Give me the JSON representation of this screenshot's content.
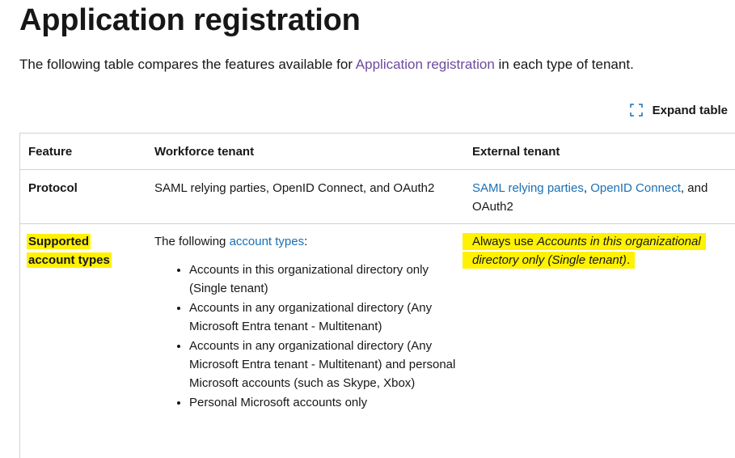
{
  "page": {
    "title": "Application registration",
    "intro": {
      "before": "The following table compares the features available for ",
      "link": "Application registration",
      "after": " in each type of tenant."
    },
    "expand_label": "Expand table",
    "expand_icon": "expand-icon"
  },
  "table": {
    "headers": [
      "Feature",
      "Workforce tenant",
      "External tenant"
    ],
    "protocol": {
      "feature": "Protocol",
      "workforce": "SAML relying parties, OpenID Connect, and OAuth2",
      "external": {
        "link1": "SAML relying parties",
        "sep1": ", ",
        "link2": "OpenID Connect",
        "sep2": ", and OAuth2"
      }
    },
    "account_types": {
      "feature": "Supported account types",
      "workforce_intro": {
        "before": "The following ",
        "link": "account types",
        "after": ":"
      },
      "workforce_items": [
        "Accounts in this organizational directory only (Single tenant)",
        "Accounts in any organizational directory (Any Microsoft Entra tenant - Multitenant)",
        "Accounts in any organizational directory (Any Microsoft Entra tenant - Multitenant) and personal Microsoft accounts (such as Skype, Xbox)",
        "Personal Microsoft accounts only"
      ],
      "external": {
        "before": "Always use ",
        "italic": "Accounts in this organizational directory only (Single tenant)",
        "after": "."
      }
    }
  },
  "colors": {
    "highlight": "#fff200",
    "link_purple": "#6c4a9e",
    "link_blue": "#1a6fb5",
    "border": "#d1d1d1",
    "text": "#171717"
  }
}
